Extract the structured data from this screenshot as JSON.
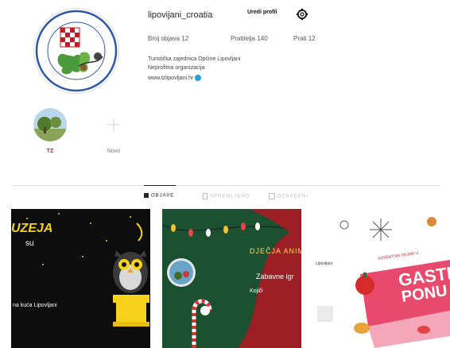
{
  "profile": {
    "username": "lipovijani_croatia",
    "edit_label": "Uredi profil",
    "posts_label": "Broj objava",
    "posts_count": "12",
    "followers_label": "Pratitelja",
    "followers_count": "140",
    "following_label": "Prati",
    "following_count": "12",
    "bio_line1": "Turistička zajednica Općine Lipovljani",
    "bio_line2": "Neprofitna organizacija",
    "website": "www.tzlipovljani.hr"
  },
  "highlights": [
    {
      "label": "TZ"
    },
    {
      "label": "Novo"
    }
  ],
  "tabs": [
    {
      "label": "OBJAVE"
    },
    {
      "label": "SPREMLJENO"
    },
    {
      "label": "OZNAČENI"
    }
  ],
  "posts": [
    {
      "title": "UZEJA",
      "line2": "su",
      "footer": "na kuća Lipovljani"
    },
    {
      "title": "DJEČJA ANIMA",
      "line2": "Zabavne igr",
      "line3": "Kojiči"
    },
    {
      "title": "ADVENTSKI SAJAM U...",
      "big1": "GASTR",
      "big2": "PONU",
      "line2": "Lipovljani"
    }
  ],
  "colors": {
    "accent": "#20a2dd",
    "post1_bg": "#0d0d0d",
    "post1_yellow": "#f7d21b",
    "post2_bg": "#1b5130",
    "post3_pink": "#e84a6e"
  }
}
